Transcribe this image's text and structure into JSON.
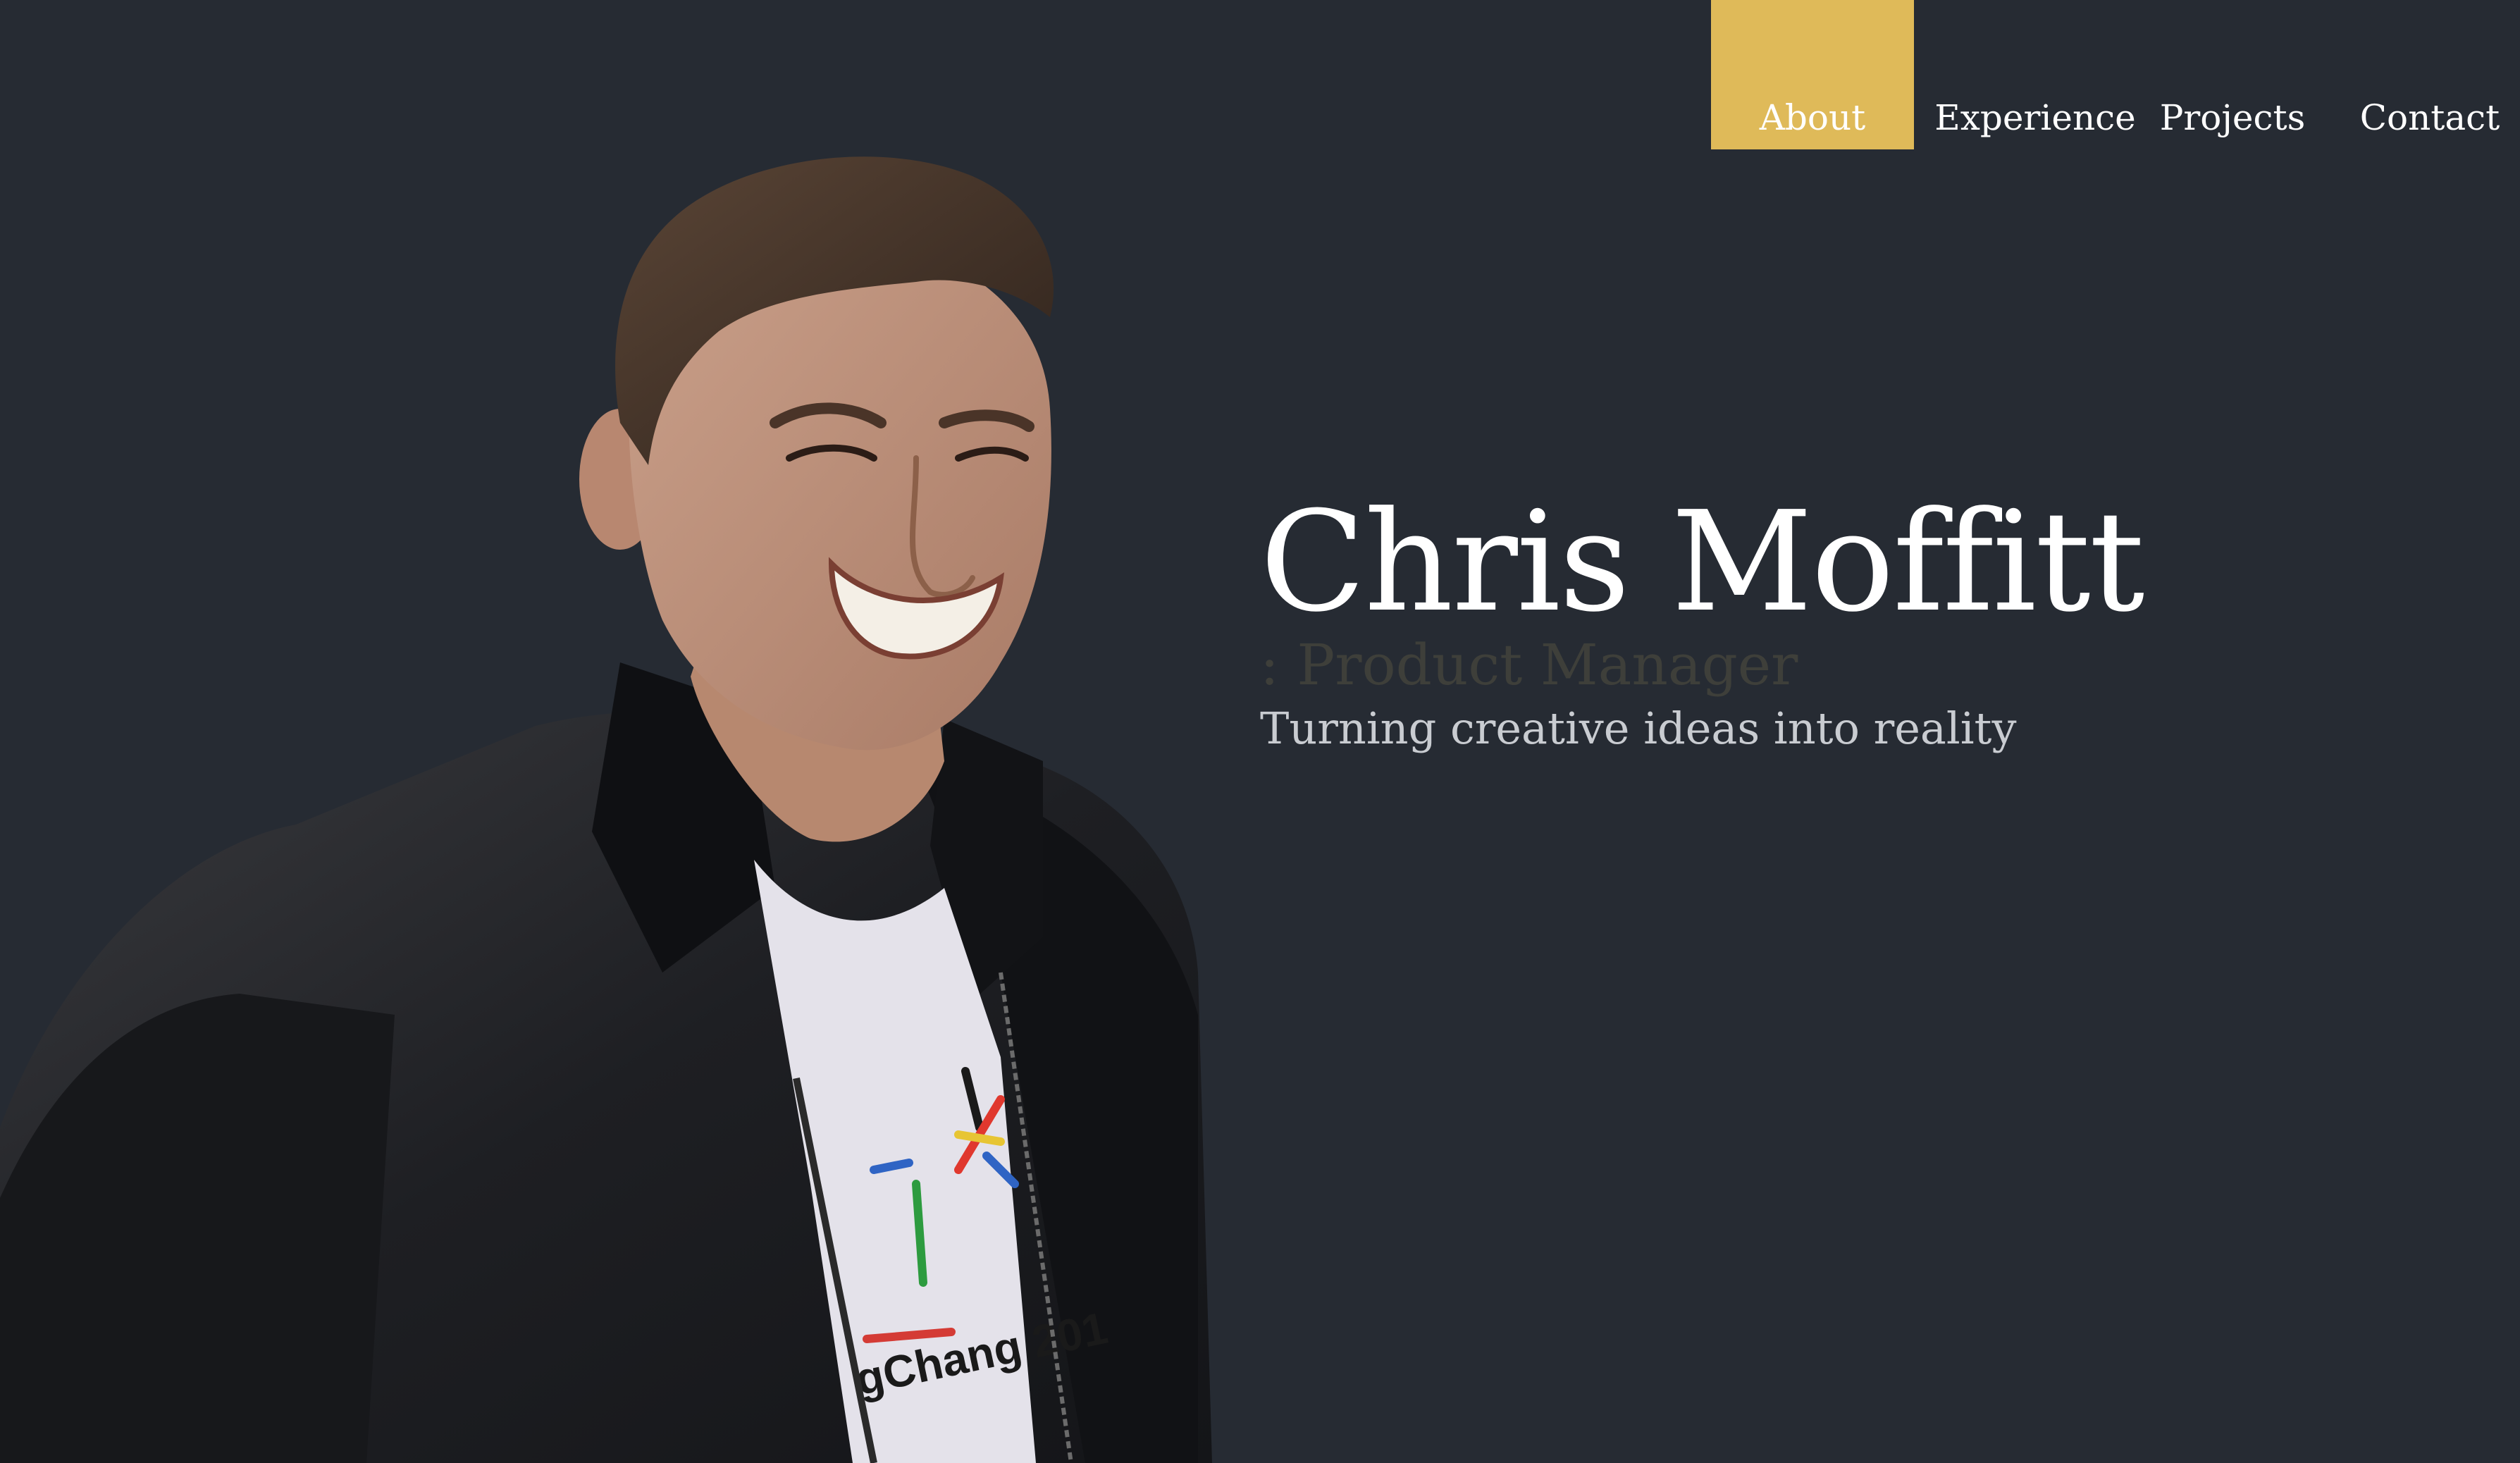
{
  "nav": {
    "items": [
      {
        "label": "About",
        "active": true
      },
      {
        "label": "Experience",
        "active": false
      },
      {
        "label": "Projects",
        "active": false
      },
      {
        "label": "Contact",
        "active": false
      }
    ],
    "active_color": "#dfba59"
  },
  "hero": {
    "name": "Chris Moffitt",
    "role": ": Product Manager",
    "tagline": "Turning creative ideas into reality"
  },
  "portrait": {
    "shirt_text": "gChang 201"
  },
  "colors": {
    "background": "#262b33",
    "accent": "#dfba59",
    "name_text": "#ffffff",
    "role_text": "#3e3f3a",
    "tagline_text": "#c9ccd1"
  }
}
